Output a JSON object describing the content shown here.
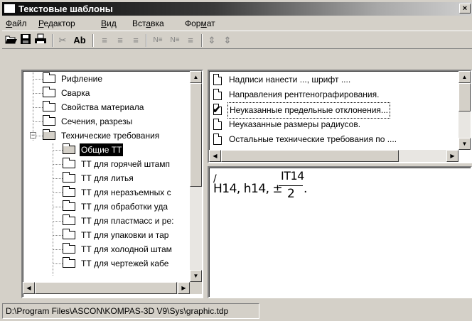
{
  "window": {
    "title": "Текстовые шаблоны",
    "close_glyph": "×"
  },
  "menu": [
    {
      "label": "Файл",
      "accel": "Ф",
      "rest": "айл"
    },
    {
      "label": "Редактор",
      "accel": "Р",
      "rest": "едактор"
    },
    {
      "label": "Вид",
      "accel": "В",
      "rest": "ид"
    },
    {
      "label": "Вставка",
      "prefix": "Вст",
      "accel": "а",
      "rest": "вка"
    },
    {
      "label": "Формат",
      "prefix": "Фор",
      "accel": "м",
      "rest": "ат"
    }
  ],
  "toolbar": {
    "open_icon": "folder-open-icon",
    "save_icon": "save-icon",
    "print_icon": "print-icon",
    "cut_glyph": "✂",
    "font_glyph": "Ab",
    "align_glyph": "≡",
    "numbering_glyph": "N≡",
    "indent_glyph": "⇕"
  },
  "tree": {
    "items": [
      {
        "label": "Рифление"
      },
      {
        "label": "Сварка"
      },
      {
        "label": "Свойства материала"
      },
      {
        "label": "Сечения, разрезы"
      },
      {
        "label": "Технические требования",
        "expanded": true,
        "expander": "−"
      },
      {
        "label": "Общие ТТ",
        "selected": true
      },
      {
        "label": "ТТ для горячей штамп"
      },
      {
        "label": "ТТ для литья"
      },
      {
        "label": "ТТ для неразъемных с"
      },
      {
        "label": "ТТ для обработки уда"
      },
      {
        "label": "ТТ для пластмасс и ре:"
      },
      {
        "label": "ТТ для упаковки и тар"
      },
      {
        "label": "ТТ для холодной штам"
      },
      {
        "label": "ТТ для чертежей кабе"
      }
    ]
  },
  "list": {
    "items": [
      {
        "label": "Надписи нанести ..., шрифт ...."
      },
      {
        "label": "Направления рентгенографирования."
      },
      {
        "label": "Неуказанные предельные отклонения...",
        "checked": true
      },
      {
        "label": "Неуказанные размеры радиусов."
      },
      {
        "label": "Остальные технические требования по ...."
      }
    ]
  },
  "preview": {
    "line": "Н14, h14, ±",
    "numerator": "IT14",
    "denominator": "2",
    "end": "."
  },
  "scroll": {
    "up": "▲",
    "down": "▼",
    "left": "◀",
    "right": "▶"
  },
  "status": {
    "path": "D:\\Program Files\\ASCON\\KOMPAS-3D V9\\Sys\\graphic.tdp"
  }
}
